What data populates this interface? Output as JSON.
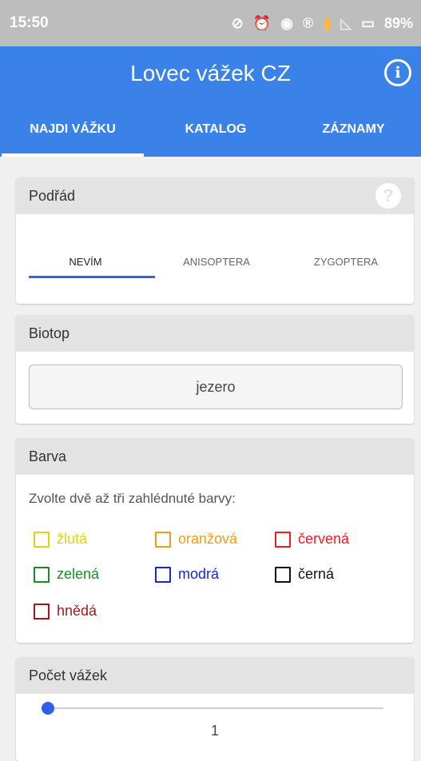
{
  "status": {
    "time": "15:50",
    "icons": [
      "no-gps-icon",
      "alarm-icon",
      "hotspot-icon",
      "registered-icon",
      "signal-icon",
      "signal-x-icon",
      "battery-icon"
    ],
    "battery": "89%"
  },
  "appbar": {
    "title": "Lovec vážek CZ",
    "info_icon": "i",
    "color": "#3b82e8"
  },
  "tabs": [
    {
      "label": "NAJDI VÁŽKU",
      "active": true
    },
    {
      "label": "KATALOG",
      "active": false
    },
    {
      "label": "ZÁZNAMY",
      "active": false
    }
  ],
  "suborder": {
    "header": "Podřád",
    "help_icon": "?",
    "options": [
      {
        "label": "NEVÍM",
        "active": true
      },
      {
        "label": "ANISOPTERA",
        "active": false
      },
      {
        "label": "ZYGOPTERA",
        "active": false
      }
    ]
  },
  "biotop": {
    "header": "Biotop",
    "value": "jezero"
  },
  "color": {
    "header": "Barva",
    "instruction": "Zvolte dvě až tři zahlédnuté barvy:",
    "options": [
      {
        "label": "žlutá",
        "color": "#e3cf1b"
      },
      {
        "label": "oranžová",
        "color": "#f39a18"
      },
      {
        "label": "červená",
        "color": "#ee1c1c"
      },
      {
        "label": "zelená",
        "color": "#1b8a2a"
      },
      {
        "label": "modrá",
        "color": "#1526e0"
      },
      {
        "label": "černá",
        "color": "#111111"
      },
      {
        "label": "hnědá",
        "color": "#9a1b1b"
      }
    ]
  },
  "count": {
    "header": "Počet vážek",
    "value": "1"
  }
}
